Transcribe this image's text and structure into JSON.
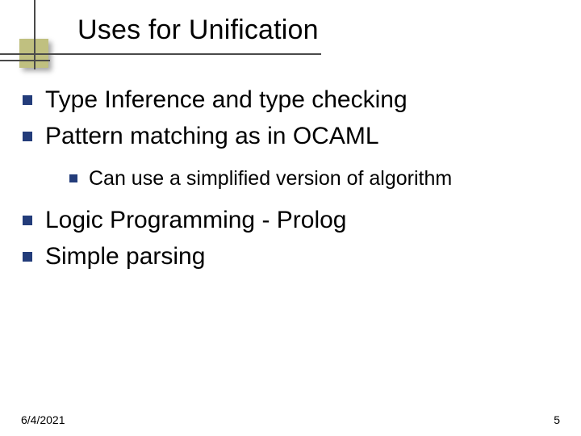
{
  "title": "Uses for Unification",
  "bullets": {
    "a": "Type Inference and type checking",
    "b": "Pattern matching as in OCAML",
    "b1": "Can use a simplified version of algorithm",
    "c": "Logic Programming - Prolog",
    "d": "Simple parsing"
  },
  "footer": {
    "date": "6/4/2021",
    "page": "5"
  },
  "colors": {
    "bullet": "#233c7a",
    "accent_square": "#c0c080",
    "line": "#4a4a4a"
  }
}
